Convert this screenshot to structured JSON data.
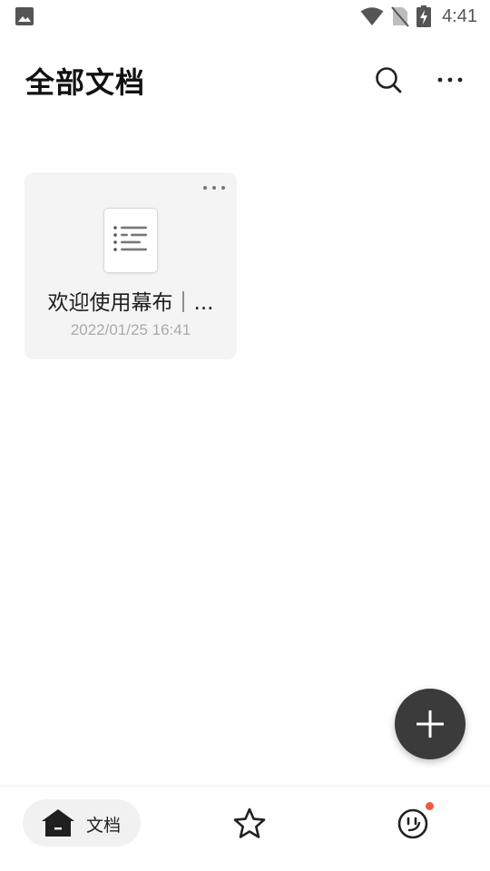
{
  "status_bar": {
    "time": "4:41",
    "icons": [
      "image-icon",
      "wifi-icon",
      "no-sim-icon",
      "battery-charging-icon"
    ]
  },
  "header": {
    "title": "全部文档",
    "icons": [
      "search-icon",
      "more-icon"
    ]
  },
  "documents": [
    {
      "title": "欢迎使用幕布｜...",
      "date": "2022/01/25 16:41",
      "icon": "document-list-icon"
    }
  ],
  "fab": {
    "icon": "plus-icon"
  },
  "bottom_nav": {
    "docs_label": "文档",
    "icons": [
      "home-icon",
      "star-icon",
      "smiley-icon"
    ],
    "colors": {
      "notification_dot": "#f25a3c",
      "fab_bg": "#3b3b3b"
    }
  }
}
